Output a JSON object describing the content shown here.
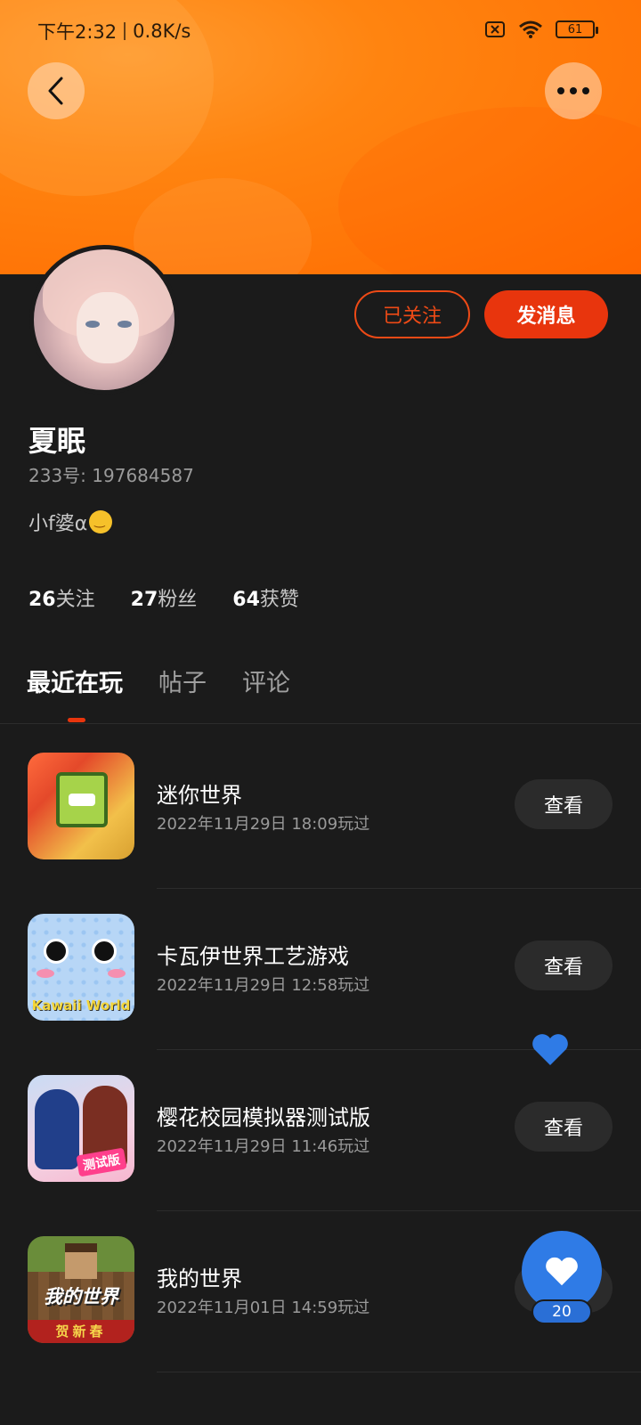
{
  "status_bar": {
    "time": "下午2:32",
    "network_speed": "0.8K/s",
    "battery": "61",
    "icons": [
      "sim-off-icon",
      "wifi-icon",
      "battery-icon"
    ]
  },
  "header": {
    "back_icon": "chevron-left-icon",
    "more_icon": "more-dots-icon"
  },
  "profile": {
    "name": "夏眠",
    "id_label": "233号: 197684587",
    "bio": "小f婆α",
    "bio_emoji": "smiling-face-icon",
    "follow_button": "已关注",
    "message_button": "发消息",
    "stats": [
      {
        "value": "26",
        "label": "关注"
      },
      {
        "value": "27",
        "label": "粉丝"
      },
      {
        "value": "64",
        "label": "获赞"
      }
    ]
  },
  "tabs": [
    {
      "label": "最近在玩",
      "active": true
    },
    {
      "label": "帖子",
      "active": false
    },
    {
      "label": "评论",
      "active": false
    }
  ],
  "games": [
    {
      "title": "迷你世界",
      "time": "2022年11月29日 18:09玩过",
      "button": "查看"
    },
    {
      "title": "卡瓦伊世界工艺游戏",
      "time": "2022年11月29日 12:58玩过",
      "button": "查看",
      "icon_text": "Kawaii World"
    },
    {
      "title": "樱花校园模拟器测试版",
      "time": "2022年11月29日 11:46玩过",
      "button": "查看",
      "icon_text": "测试版"
    },
    {
      "title": "我的世界",
      "time": "2022年11月01日 14:59玩过",
      "button": "查看",
      "icon_text": "我的世界",
      "icon_banner": "贺新春"
    }
  ],
  "fab": {
    "icon": "heart-icon",
    "count": "20"
  },
  "colors": {
    "accent": "#e8350d",
    "cover": "#ff8410",
    "background": "#1b1b1b",
    "fab": "#2f7be6"
  }
}
